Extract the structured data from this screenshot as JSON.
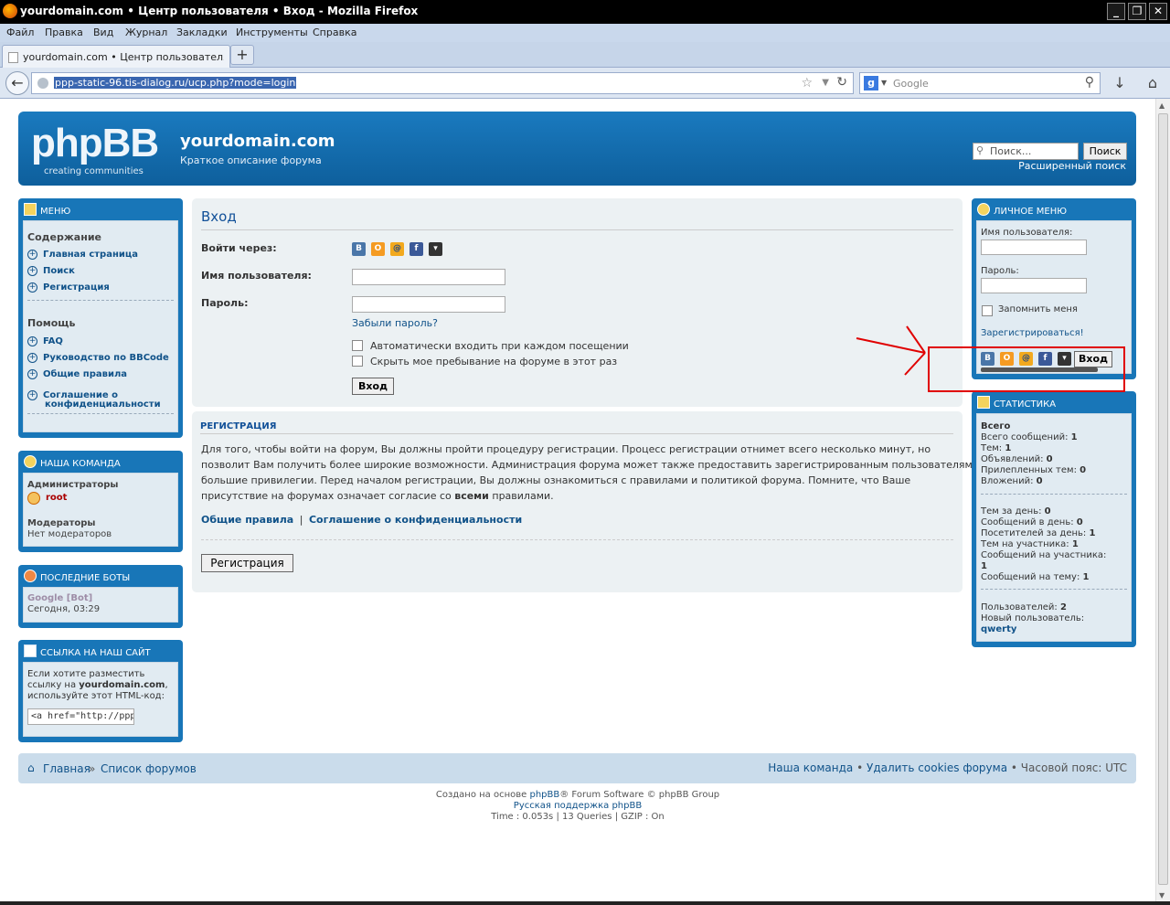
{
  "window": {
    "title": "yourdomain.com • Центр пользователя • Вход - Mozilla Firefox",
    "buttons": [
      "_",
      "❐",
      "✕"
    ]
  },
  "menubar": [
    "Файл",
    "Правка",
    "Вид",
    "Журнал",
    "Закладки",
    "Инструменты",
    "Справка"
  ],
  "tab": {
    "title": "yourdomain.com • Центр пользователя • В...",
    "new_tab": "+"
  },
  "navbar": {
    "url": "ppp-static-96.tis-dialog.ru/ucp.php?mode=login",
    "search_placeholder": "Google",
    "search_engine_letter": "g"
  },
  "header": {
    "logo": "phpBB",
    "logo_tag": "creating   communities",
    "site_name": "yourdomain.com",
    "site_desc": "Краткое описание форума",
    "search_placeholder": "Поиск...",
    "search_button": "Поиск",
    "advanced_search": "Расширенный поиск"
  },
  "left": {
    "menu": {
      "title": "МЕНЮ",
      "contents_heading": "Содержание",
      "contents": [
        "Главная страница",
        "Поиск",
        "Регистрация"
      ],
      "help_heading": "Помощь",
      "help": [
        "FAQ",
        "Руководство по BBCode",
        "Общие правила",
        "Соглашение о",
        "конфиденциальности"
      ]
    },
    "team": {
      "title": "НАША КОМАНДА",
      "admins_label": "Администраторы",
      "admin": "root",
      "mods_label": "Модераторы",
      "mods_value": "Нет модераторов"
    },
    "bots": {
      "title": "ПОСЛЕДНИЕ БОТЫ",
      "bot": "Google [Bot]",
      "time": "Сегодня, 03:29"
    },
    "link": {
      "title": "ССЫЛКА НА НАШ САЙТ",
      "text1": "Если хотите разместить",
      "text2a": "ссылку на ",
      "text2b": "yourdomain.com",
      "text2c": ",",
      "text3": "используйте этот HTML-код:",
      "code": "<a href=\"http://ppp"
    }
  },
  "login": {
    "title": "Вход",
    "via_label": "Войти через:",
    "username_label": "Имя пользователя:",
    "password_label": "Пароль:",
    "forgot": "Забыли пароль?",
    "auto_login": "Автоматически входить при каждом посещении",
    "hide_online": "Скрыть мое пребывание на форуме в этот раз",
    "submit": "Вход",
    "social": [
      "В",
      "О",
      "@",
      "f",
      "▾"
    ]
  },
  "registration": {
    "title": "РЕГИСТРАЦИЯ",
    "line1": "Для того, чтобы войти на форум, Вы должны пройти процедуру регистрации. Процесс регистрации отнимет всего несколько минут, но",
    "line2": "позволит Вам получить более широкие возможности. Администрация форума может также предоставить зарегистрированным пользователям",
    "line3": "большие привилегии. Перед началом регистрации, Вы должны ознакомиться с правилами и политикой форума. Помните, что Ваше",
    "line4a": "присутствие на форумах означает согласие со ",
    "line4b": "всеми",
    "line4c": " правилами.",
    "link_rules": "Общие правила",
    "separator": "|",
    "link_privacy": "Соглашение о конфиденциальности",
    "button": "Регистрация"
  },
  "right": {
    "personal": {
      "title": "ЛИЧНОЕ МЕНЮ",
      "username_label": "Имя пользователя:",
      "password_label": "Пароль:",
      "remember": "Запомнить меня",
      "register": "Зарегистрироваться!",
      "login_button": "Вход"
    },
    "stats": {
      "title": "СТАТИСТИКА",
      "total_heading": "Всего",
      "block1": [
        {
          "label": "Всего сообщений: ",
          "value": "1"
        },
        {
          "label": "Тем: ",
          "value": "1"
        },
        {
          "label": "Объявлений: ",
          "value": "0"
        },
        {
          "label": "Прилепленных тем: ",
          "value": "0"
        },
        {
          "label": "Вложений: ",
          "value": "0"
        }
      ],
      "block2": [
        {
          "label": "Тем за день: ",
          "value": "0"
        },
        {
          "label": "Сообщений в день: ",
          "value": "0"
        },
        {
          "label": "Посетителей за день: ",
          "value": "1"
        },
        {
          "label": "Тем на участника: ",
          "value": "1"
        },
        {
          "label": "Сообщений на участника:",
          "value": ""
        },
        {
          "label": "",
          "value": "1"
        },
        {
          "label": "Сообщений на тему: ",
          "value": "1"
        }
      ],
      "users_label": "Пользователей: ",
      "users_value": "2",
      "newest_label": "Новый пользователь:",
      "newest_value": "qwerty"
    }
  },
  "footer": {
    "home": "Главная",
    "sep": "»",
    "forums": "Список форумов",
    "team": "Наша команда",
    "dot": "•",
    "cookies": "Удалить cookies форума",
    "timezone": "Часовой пояс: UTC"
  },
  "credits": {
    "prefix": "Создано на основе ",
    "phpbb": "phpBB",
    "suffix": "® Forum Software © phpBB Group",
    "ru": "Русская поддержка phpBB",
    "time": "Time : 0.053s | 13 Queries | GZIP : On"
  },
  "colors": {
    "header_blue": "#1876b8",
    "link_blue": "#105289",
    "admin_red": "#aa0000",
    "annotation_red": "#e00000"
  }
}
